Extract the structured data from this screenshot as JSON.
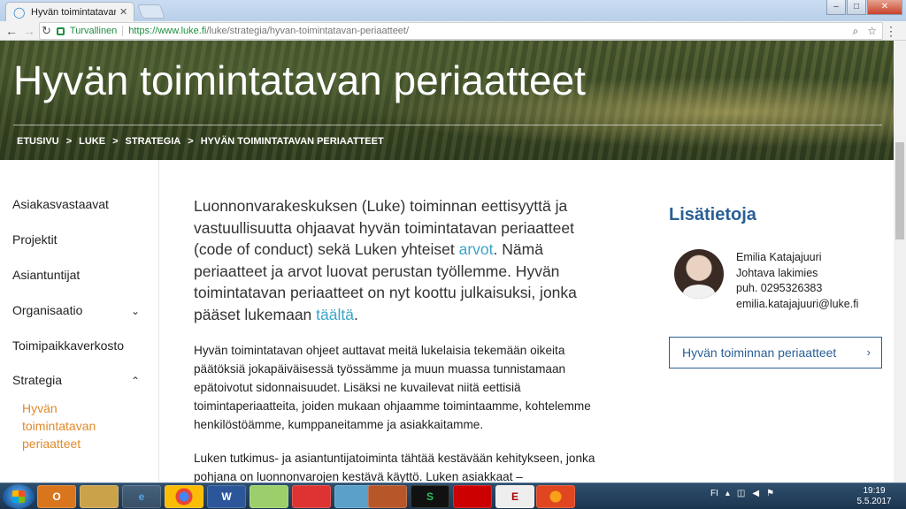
{
  "browser": {
    "tab_title": "Hyvän toimintatavan periaatteet",
    "secure_label": "Turvallinen",
    "url_host": "https://www.luke.fi",
    "url_path": "/luke/strategia/hyvan-toimintatavan-periaatteet/"
  },
  "hero": {
    "title": "Hyvän toimintatavan periaatteet",
    "breadcrumb": [
      "ETUSIVU",
      ">",
      "LUKE",
      ">",
      "STRATEGIA",
      ">",
      "HYVÄN TOIMINTATAVAN PERIAATTEET"
    ]
  },
  "sidebar": {
    "items": [
      "Asiakasvastaavat",
      "Projektit",
      "Asiantuntijat",
      "Organisaatio",
      "Toimipaikkaverkosto",
      "Strategia"
    ],
    "sub_item": "Hyvän toimintatavan periaatteet"
  },
  "main": {
    "lead_1": "Luonnonvarakeskuksen (Luke) toiminnan eettisyyttä ja vastuullisuutta ohjaavat hyvän toimintatavan periaatteet (code of conduct) sekä Luken yhteiset ",
    "lead_link_1": "arvot",
    "lead_2": ". Nämä periaatteet ja arvot luovat perustan työllemme. Hyvän toimintatavan periaatteet on nyt koottu julkaisuksi, jonka pääset lukemaan ",
    "lead_link_2": "täältä",
    "lead_3": ".",
    "para_1": "Hyvän toimintatavan ohjeet auttavat meitä lukelaisia tekemään oikeita päätöksiä jokapäiväisessä työssämme ja muun muassa tunnistamaan epätoivotut sidonnaisuudet. Lisäksi ne kuvailevat niitä eettisiä toimintaperiaatteita, joiden mukaan ohjaamme toimintaamme, kohtelemme henkilöstöämme, kumppaneitamme ja asiakkaitamme.",
    "para_2": "Luken tutkimus- ja asiantuntijatoiminta tähtää kestävään kehitykseen, jonka pohjana on luonnonvarojen kestävä käyttö. Luken asiakkaat –"
  },
  "aside": {
    "title": "Lisätietoja",
    "contact_name": "Emilia Katajajuuri",
    "contact_role": "Johtava lakimies",
    "contact_phone": "puh. 0295326383",
    "contact_email": "emilia.katajajuuri@luke.fi",
    "cta_label": "Hyvän toiminnan periaatteet"
  },
  "taskbar": {
    "apps": [
      "O",
      "",
      "e",
      "",
      "W",
      "",
      "",
      "",
      "",
      "S",
      "",
      "E",
      ""
    ],
    "lang": "FI",
    "time": "19:19",
    "date": "5.5.2017"
  }
}
